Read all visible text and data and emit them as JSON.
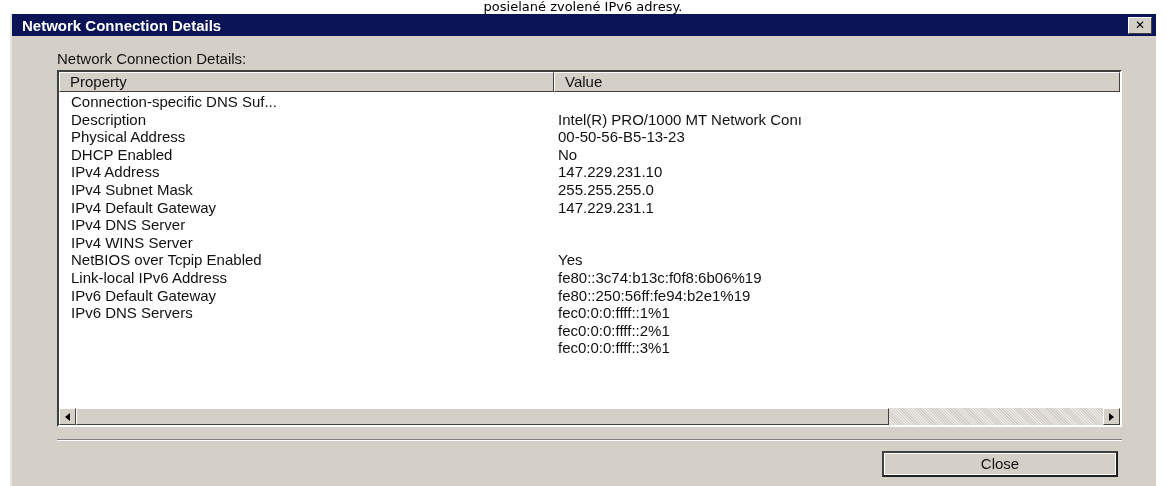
{
  "caption": "posielané zvolené IPv6 adresy.",
  "window": {
    "title": "Network Connection Details",
    "close_glyph": "✕"
  },
  "label": "Network Connection Details:",
  "table": {
    "columns": [
      "Property",
      "Value"
    ],
    "rows": [
      {
        "property": "Connection-specific DNS Suf..."
      },
      {
        "property": "Description",
        "value": "Intel(R) PRO/1000 MT Network Conı"
      },
      {
        "property": "Physical Address",
        "value": "00-50-56-B5-13-23"
      },
      {
        "property": "DHCP Enabled",
        "value": "No"
      },
      {
        "property": "IPv4 Address",
        "value": "147.229.231.10"
      },
      {
        "property": "IPv4 Subnet Mask",
        "value": "255.255.255.0"
      },
      {
        "property": "IPv4 Default Gateway",
        "value": "147.229.231.1"
      },
      {
        "property": "IPv4 DNS Server"
      },
      {
        "property": "IPv4 WINS Server"
      },
      {
        "property": "NetBIOS over Tcpip Enabled",
        "value": "Yes"
      },
      {
        "property": "Link-local IPv6 Address",
        "value": "fe80::3c74:b13c:f0f8:6b06%19"
      },
      {
        "property": "IPv6 Default Gateway",
        "value": "fe80::250:56ff:fe94:b2e1%19"
      },
      {
        "property": "IPv6 DNS Servers",
        "value": "fec0:0:0:ffff::1%1"
      },
      {
        "value": "fec0:0:0:ffff::2%1"
      },
      {
        "value": "fec0:0:0:ffff::3%1"
      }
    ]
  },
  "buttons": [
    "Close"
  ]
}
